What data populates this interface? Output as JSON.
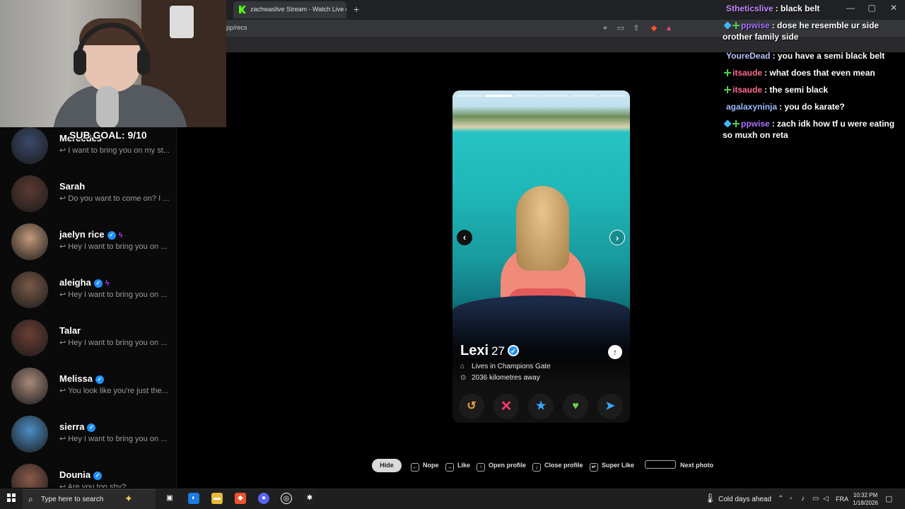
{
  "browser": {
    "tab_title": "zachwaslive Stream - Watch Live on Kick",
    "new_tab_symbol": "+",
    "url": "pp/recs",
    "window_controls": [
      "—",
      "▢",
      "✕"
    ]
  },
  "overlay": {
    "sub_goal": "SUB GOAL: 9/10"
  },
  "matches": [
    {
      "name": "Mercedes",
      "verified": false,
      "boosted": false,
      "message": "I want to bring you on my st..."
    },
    {
      "name": "Sarah",
      "verified": false,
      "boosted": false,
      "message": "Do you want to come on? I ..."
    },
    {
      "name": "jaelyn rice",
      "verified": true,
      "boosted": true,
      "message": "Hey I want to bring you on ..."
    },
    {
      "name": "aleigha",
      "verified": true,
      "boosted": true,
      "message": "Hey I want to bring you on ..."
    },
    {
      "name": "Talar",
      "verified": false,
      "boosted": false,
      "message": "Hey I want to bring you on ..."
    },
    {
      "name": "Melissa",
      "verified": true,
      "boosted": false,
      "message": "You look like you're just the..."
    },
    {
      "name": "sierra",
      "verified": true,
      "boosted": false,
      "message": "Hey I want to bring you on ..."
    },
    {
      "name": "Dounia",
      "verified": true,
      "boosted": false,
      "message": "Are you too shy?"
    }
  ],
  "profile": {
    "name": "Lexi",
    "age": "27",
    "verified_symbol": "✓",
    "lives_in": "Lives in Champions Gate",
    "distance": "2036 kilometres away",
    "photo_count": 6,
    "active_photo_index": 1
  },
  "actions": {
    "rewind": "↺",
    "nope": "✕",
    "super_like": "★",
    "like": "♥",
    "boost": "➤"
  },
  "hints": {
    "hide": "Hide",
    "nope": "Nope",
    "like": "Like",
    "open_profile": "Open profile",
    "close_profile": "Close profile",
    "super_like": "Super Like",
    "next_photo": "Next photo"
  },
  "chat": [
    {
      "user": "Stheticslive",
      "color": "#c58cff",
      "badges": [],
      "text": "black belt"
    },
    {
      "user": "ppwise",
      "color": "#a873ff",
      "badges": [
        "blue",
        "green"
      ],
      "text": "dose he resemble ur side orother family side"
    },
    {
      "user": "YoureDead",
      "color": "#b7c7ff",
      "badges": [],
      "text": "you have a semi black belt"
    },
    {
      "user": "itsaude",
      "color": "#ff6a8a",
      "badges": [
        "green"
      ],
      "text": "what does that even mean"
    },
    {
      "user": "itsaude",
      "color": "#ff6a8a",
      "badges": [
        "green"
      ],
      "text": "the semi black"
    },
    {
      "user": "agalaxyninja",
      "color": "#9ab9ff",
      "badges": [],
      "text": "you do karate?"
    },
    {
      "user": "ppwise",
      "color": "#a873ff",
      "badges": [
        "blue",
        "green"
      ],
      "text": "zach idk how tf u were eating so muxh on reta"
    }
  ],
  "taskbar": {
    "search_placeholder": "Type here to search",
    "weather": "Cold days ahead",
    "language": "FRA",
    "time": "10:32 PM",
    "date": "1/18/2026"
  }
}
